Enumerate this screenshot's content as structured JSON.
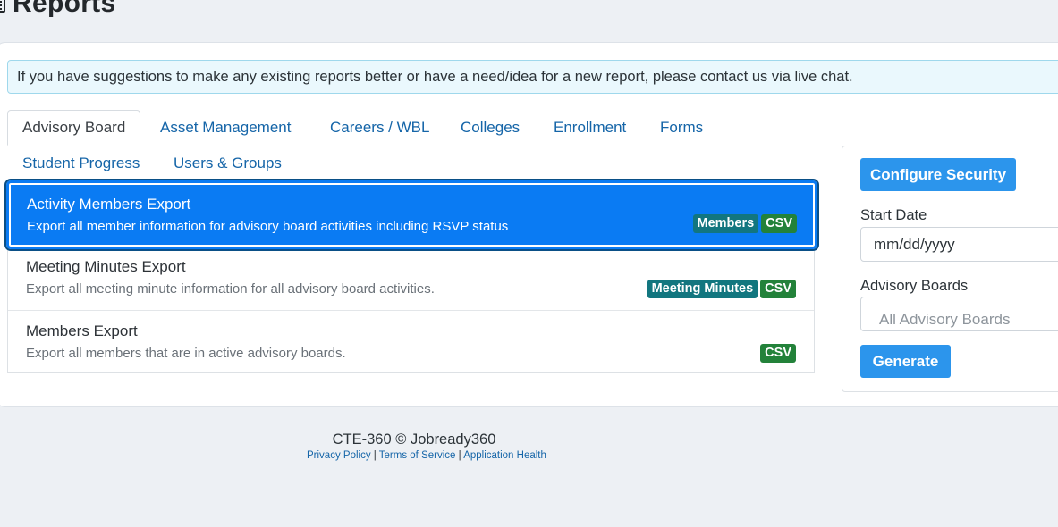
{
  "page": {
    "title": "Reports"
  },
  "info": {
    "text": "If you have suggestions to make any existing reports better or have a need/idea for a new report, please contact us via live chat."
  },
  "tabs": [
    {
      "label": "Advisory Board",
      "active": true
    },
    {
      "label": "Asset Management"
    },
    {
      "label": "Careers / WBL"
    },
    {
      "label": "Colleges"
    },
    {
      "label": "Enrollment"
    },
    {
      "label": "Forms"
    },
    {
      "label": "Student Progress"
    },
    {
      "label": "Users & Groups"
    }
  ],
  "reports": [
    {
      "title": "Activity Members Export",
      "desc": "Export all member information for advisory board activities including RSVP status",
      "badges": [
        "Members",
        "CSV"
      ],
      "selected": true
    },
    {
      "title": "Meeting Minutes Export",
      "desc": "Export all meeting minute information for all advisory board activities.",
      "badges": [
        "Meeting Minutes",
        "CSV"
      ]
    },
    {
      "title": "Members Export",
      "desc": "Export all members that are in active advisory boards.",
      "badges": [
        "CSV"
      ]
    }
  ],
  "side": {
    "configure_label": "Configure Security",
    "start_date_label": "Start Date",
    "start_date_placeholder": "mm/dd/yyyy",
    "boards_label": "Advisory Boards",
    "boards_placeholder": "All Advisory Boards",
    "generate_label": "Generate"
  },
  "footer": {
    "copy": "CTE-360 © Jobready360",
    "privacy": "Privacy Policy",
    "terms": "Terms of Service",
    "health": "Application Health",
    "sep": "|"
  },
  "colors": {
    "primary": "#0a7bf3",
    "button": "#2c95ec",
    "badge_teal": "#12767f",
    "badge_green": "#23823a",
    "link": "#1565a8"
  }
}
